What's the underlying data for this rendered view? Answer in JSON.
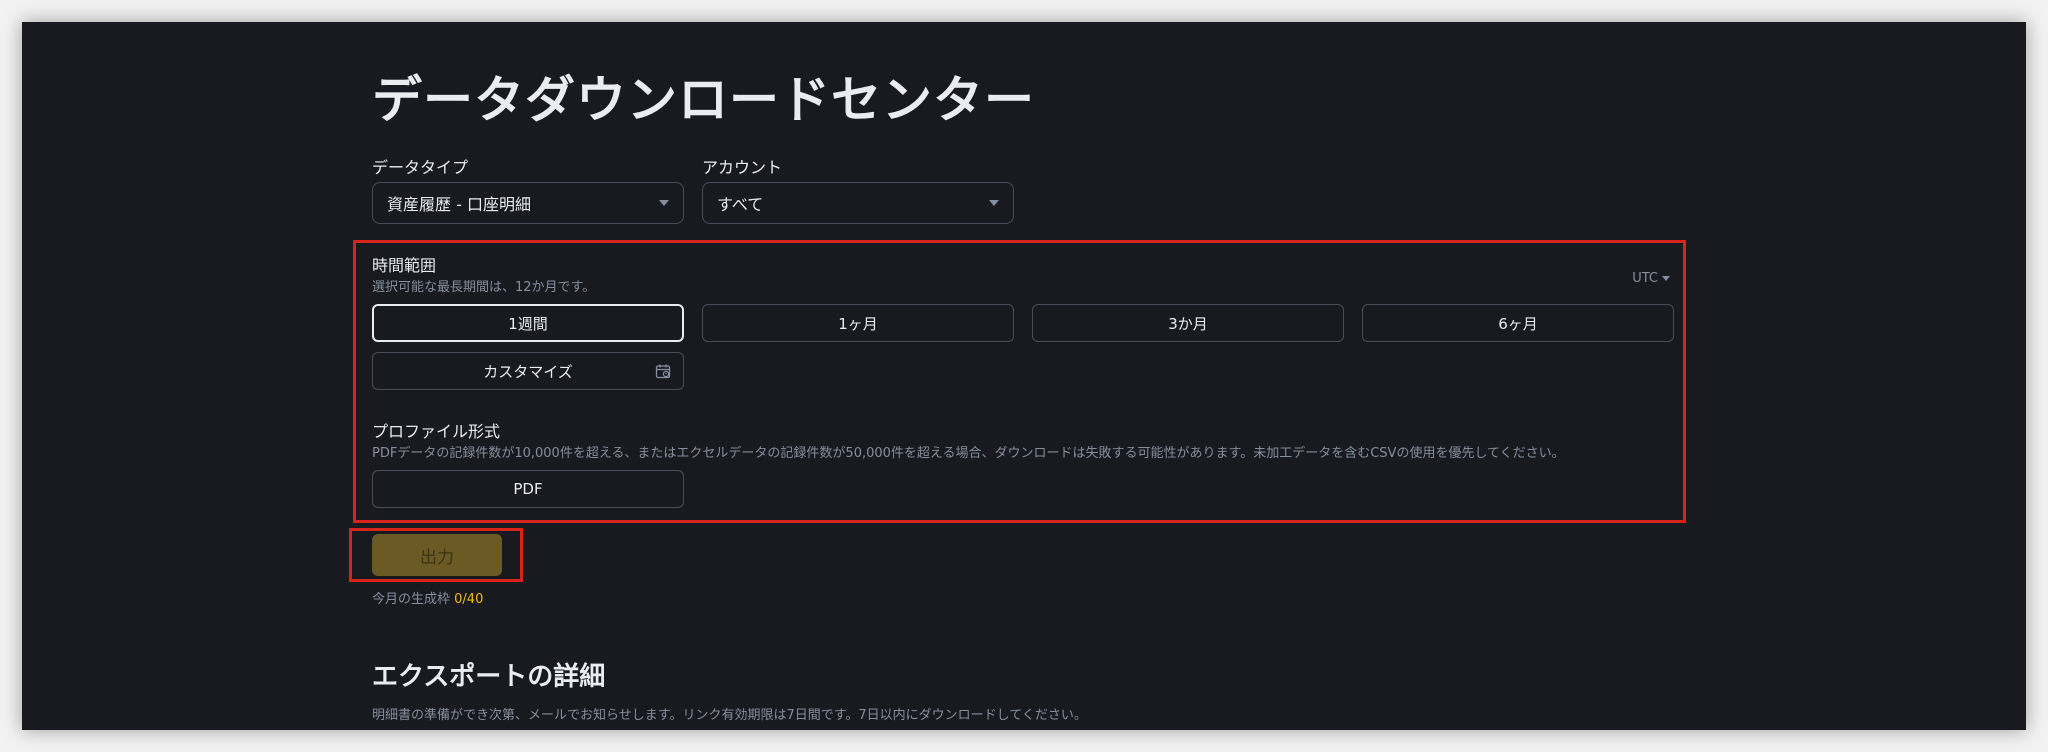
{
  "page": {
    "title": "データダウンロードセンター"
  },
  "filters": {
    "data_type": {
      "label": "データタイプ",
      "value": "資産履歴 - 口座明細"
    },
    "account": {
      "label": "アカウント",
      "value": "すべて"
    }
  },
  "time_range": {
    "label": "時間範囲",
    "hint": "選択可能な最長期間は、12か月です。",
    "timezone": "UTC",
    "options": [
      "1週間",
      "1ヶ月",
      "3か月",
      "6ヶ月"
    ],
    "selected": "1週間",
    "custom_label": "カスタマイズ"
  },
  "profile_format": {
    "label": "プロファイル形式",
    "hint": "PDFデータの記録件数が10,000件を超える、またはエクセルデータの記録件数が50,000件を超える場合、ダウンロードは失敗する可能性があります。未加工データを含むCSVの使用を優先してください。",
    "option": "PDF"
  },
  "export": {
    "button_label": "出力",
    "quota_label": "今月の生成枠",
    "quota_value": "0/40"
  },
  "details": {
    "title": "エクスポートの詳細",
    "text": "明細書の準備ができ次第、メールでお知らせします。リンク有効期限は7日間です。7日以内にダウンロードしてください。"
  },
  "colors": {
    "background": "#181a20",
    "accent": "#f0b90b",
    "highlight_box": "#d62518"
  }
}
